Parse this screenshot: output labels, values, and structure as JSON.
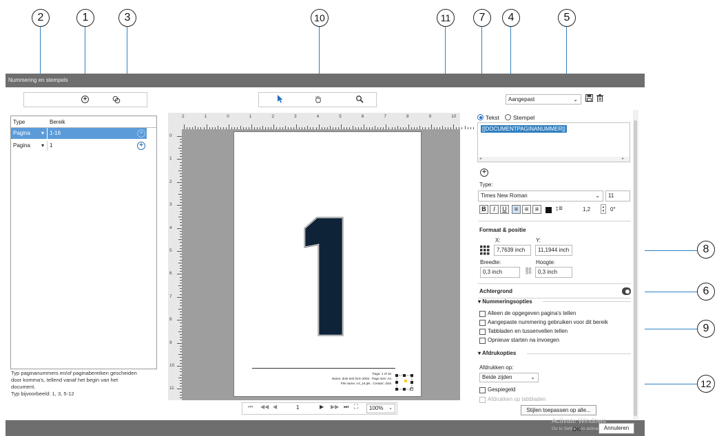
{
  "callouts": [
    "1",
    "2",
    "3",
    "4",
    "5",
    "6",
    "7",
    "8",
    "9",
    "10",
    "11",
    "12"
  ],
  "window": {
    "title": "Nummering en stempels"
  },
  "range_panel": {
    "headers": [
      "Type",
      "Bereik"
    ],
    "rows": [
      {
        "type": "Pagina",
        "range": "1-16"
      },
      {
        "type": "Pagina",
        "range": "1"
      }
    ],
    "help_text": [
      "Typ paginanummers en/of paginabereiken gescheiden",
      "door komma's, tellend vanaf het begin van het",
      "document.",
      "Typ bijvoorbeeld: 1, 3, 5-12"
    ]
  },
  "ruler": {
    "h_labels": [
      "2",
      "1",
      "0",
      "1",
      "2",
      "3",
      "4",
      "5",
      "6",
      "7",
      "8",
      "9",
      "10"
    ],
    "v_labels": [
      "0",
      "1",
      "2",
      "3",
      "4",
      "5",
      "6",
      "7",
      "8",
      "9",
      "10",
      "11"
    ]
  },
  "page": {
    "big_number": "1",
    "stamp_lines": [
      "Page: 1 of 16",
      "Name: dots test form 2003 . Page size: A4",
      "File name: A4_16.pls . Creator: dots"
    ]
  },
  "navigation": {
    "page_value": "1",
    "zoom": "100%"
  },
  "right_panel": {
    "preset": "Aangepast",
    "mode_text": "Tekst",
    "mode_stamp": "Stempel",
    "text_content": "[[DOCUMENTPAGINANUMMER]]",
    "type_label": "Type:",
    "font": "Times New Roman",
    "font_size": "11",
    "line_spacing": "1,2",
    "rotation": "0°",
    "format_heading": "Formaat & positie",
    "x_label": "X:",
    "x_value": "7,7639 inch",
    "y_label": "Y:",
    "y_value": "11,1944 inch",
    "width_label": "Breedte:",
    "width_value": "0,3 inch",
    "height_label": "Hoogte:",
    "height_value": "0,3 inch",
    "background_label": "Achtergrond",
    "numbering_heading": "Nummeringsopties",
    "numbering_options": [
      "Alleen de opgegeven pagina's tellen",
      "Aangepaste nummering gebruiken voor dit bereik",
      "Tabbladen en tussenvellen tellen",
      "Opnieuw starten na invoegen"
    ],
    "print_heading": "Afdrukopties",
    "print_on_label": "Afdrukken op:",
    "print_on_value": "Beide zijden",
    "mirror_label": "Gespiegeld",
    "print_tabs_label": "Afdrukken op tabbladen",
    "apply_all_button": "Stijlen toepassen op alle..."
  },
  "footer": {
    "watermark_line1": "Activate Windows",
    "watermark_line2": "Go to Settings to activate",
    "ok_button": "OK",
    "cancel_button": "Annuleren"
  },
  "colors": {
    "accent": "#2f7fc1",
    "selection": "#4a90d9",
    "chrome": "#6e6e6e",
    "page_bg": "#9e9e9e",
    "number_fill": "#0e2238"
  }
}
